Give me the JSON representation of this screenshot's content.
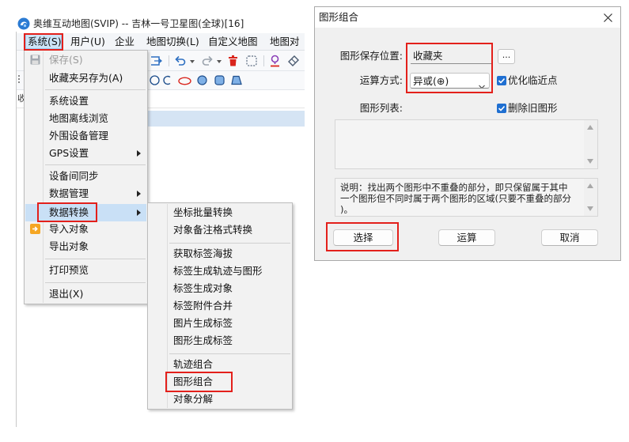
{
  "app": {
    "title": "奥维互动地图(SVIP) -- 吉林一号卫星图(全球)[16]",
    "logo_icon": "ovital-logo",
    "menu_bar": [
      {
        "label": "系统(S)",
        "active": true
      },
      {
        "label": "用户(U)"
      },
      {
        "label": "企业"
      },
      {
        "label": "地图切换(L)"
      },
      {
        "label": "自定义地图"
      },
      {
        "label": "地图对"
      }
    ],
    "toolbar_row1_icons": [
      "select-frame",
      "undo",
      "redo",
      "delete",
      "dashed-select",
      "pin",
      "eraser"
    ],
    "toolbar_row2_icons": [
      "circle",
      "arc",
      "ellipse",
      "filled-circle",
      "rounded-square",
      "polygon"
    ],
    "side_tab": "收"
  },
  "system_menu": {
    "items": [
      {
        "label": "保存(S)",
        "disabled": true,
        "icon": "save"
      },
      {
        "label": "收藏夹另存为(A)"
      },
      {
        "label": "系统设置"
      },
      {
        "label": "地图离线浏览"
      },
      {
        "label": "外围设备管理"
      },
      {
        "label": "GPS设置",
        "submenu": true
      },
      {
        "label": "设备间同步"
      },
      {
        "label": "数据管理",
        "submenu": true
      },
      {
        "label": "数据转换",
        "submenu": true,
        "highlighted": true
      },
      {
        "label": "导入对象",
        "icon": "import"
      },
      {
        "label": "导出对象"
      },
      {
        "label": "打印预览"
      },
      {
        "label": "退出(X)"
      }
    ]
  },
  "data_convert_submenu": {
    "items": [
      {
        "label": "坐标批量转换"
      },
      {
        "label": "对象备注格式转换"
      },
      {
        "label": "获取标签海拔"
      },
      {
        "label": "标签生成轨迹与图形"
      },
      {
        "label": "标签生成对象"
      },
      {
        "label": "标签附件合并"
      },
      {
        "label": "图片生成标签"
      },
      {
        "label": "图形生成标签"
      },
      {
        "label": "轨迹组合"
      },
      {
        "label": "图形组合",
        "highlighted": true
      },
      {
        "label": "对象分解"
      }
    ]
  },
  "dialog": {
    "title": "图形组合",
    "save_location_label": "图形保存位置:",
    "save_location_value": "收藏夹",
    "browse_label": "...",
    "operation_label": "运算方式:",
    "operation_value": "异或(⊕)",
    "optimize_checkbox": {
      "label": "优化临近点",
      "checked": true
    },
    "shape_list_label": "图形列表:",
    "delete_old_checkbox": {
      "label": "删除旧图形",
      "checked": true
    },
    "description_lines": [
      "说明：找出两个图形中不重叠的部分，即只保留属于其中",
      "一个图形但不同时属于两个图形的区域(只要不重叠的部分",
      ")。"
    ],
    "buttons": {
      "select": "选择",
      "compute": "运算",
      "cancel": "取消"
    }
  },
  "colors": {
    "highlight_red": "#e3201b",
    "menu_hover": "#c9e0f6",
    "checkbox_blue": "#1f6fd1",
    "icon_blue": "#2d6fc1"
  }
}
